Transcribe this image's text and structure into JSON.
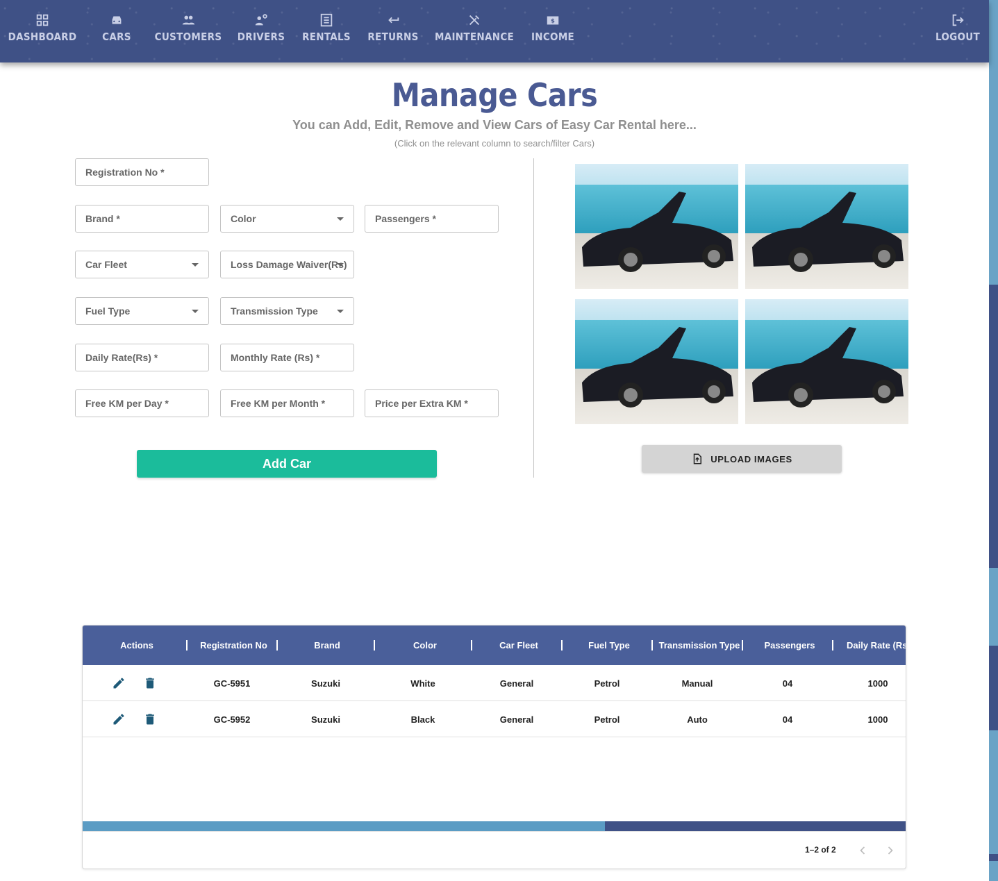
{
  "nav": {
    "items": [
      {
        "label": "DASHBOARD",
        "icon": "grid-icon"
      },
      {
        "label": "CARS",
        "icon": "car-icon"
      },
      {
        "label": "CUSTOMERS",
        "icon": "people-icon"
      },
      {
        "label": "DRIVERS",
        "icon": "driver-icon"
      },
      {
        "label": "RENTALS",
        "icon": "list-icon"
      },
      {
        "label": "RETURNS",
        "icon": "return-arrow-icon"
      },
      {
        "label": "MAINTENANCE",
        "icon": "tools-icon"
      },
      {
        "label": "INCOME",
        "icon": "money-icon"
      }
    ],
    "logout": {
      "label": "LOGOUT",
      "icon": "logout-icon"
    }
  },
  "header": {
    "title": "Manage Cars",
    "subtitle": "You can Add, Edit, Remove and View Cars of Easy Car Rental here...",
    "hint": "(Click on the relevant column to search/filter Cars)"
  },
  "form": {
    "registration_no": "Registration No *",
    "brand": "Brand *",
    "color": "Color",
    "passengers": "Passengers *",
    "car_fleet": "Car Fleet",
    "loss_damage_waiver": "Loss Damage Waiver(Rs)",
    "fuel_type": "Fuel Type",
    "transmission_type": "Transmission Type",
    "daily_rate": "Daily Rate(Rs) *",
    "monthly_rate": "Monthly Rate (Rs) *",
    "free_km_day": "Free KM per Day *",
    "free_km_month": "Free KM per Month *",
    "price_extra_km": "Price per Extra KM *",
    "add_button": "Add Car"
  },
  "images": {
    "upload_label": "UPLOAD IMAGES",
    "upload_icon": "upload-file-icon",
    "count": 4
  },
  "table": {
    "columns": [
      "Actions",
      "Registration No",
      "Brand",
      "Color",
      "Car Fleet",
      "Fuel Type",
      "Transmission Type",
      "Passengers",
      "Daily Rate (Rs"
    ],
    "rows": [
      {
        "registration_no": "GC-5951",
        "brand": "Suzuki",
        "color": "White",
        "car_fleet": "General",
        "fuel_type": "Petrol",
        "transmission": "Manual",
        "passengers": "04",
        "daily_rate": "1000"
      },
      {
        "registration_no": "GC-5952",
        "brand": "Suzuki",
        "color": "Black",
        "car_fleet": "General",
        "fuel_type": "Petrol",
        "transmission": "Auto",
        "passengers": "04",
        "daily_rate": "1000"
      }
    ],
    "pagination": "1–2 of 2"
  },
  "colors": {
    "nav_bg": "#3f5186",
    "title": "#4a5a93",
    "add_button": "#1bbc9b",
    "table_header": "#4a5f9a",
    "scroll_thumb": "#5b9cc4",
    "action_icons": "#1e5a78"
  }
}
